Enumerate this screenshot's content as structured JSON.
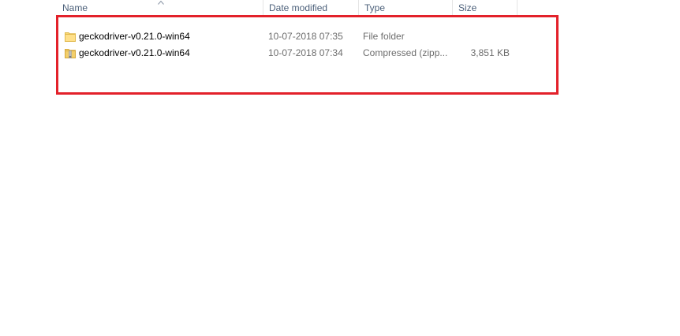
{
  "columns": {
    "name": "Name",
    "date_modified": "Date modified",
    "type": "Type",
    "size": "Size"
  },
  "sort": {
    "column": "name",
    "direction": "ascending",
    "icon": "chevron-up-icon"
  },
  "highlight": {
    "color": "#e3212a"
  },
  "files": [
    {
      "icon": "folder-icon",
      "name": "geckodriver-v0.21.0-win64",
      "date_modified": "10-07-2018 07:35",
      "type": "File folder",
      "size": ""
    },
    {
      "icon": "zip-folder-icon",
      "name": "geckodriver-v0.21.0-win64",
      "date_modified": "10-07-2018 07:34",
      "type": "Compressed (zipp...",
      "size": "3,851 KB"
    }
  ]
}
